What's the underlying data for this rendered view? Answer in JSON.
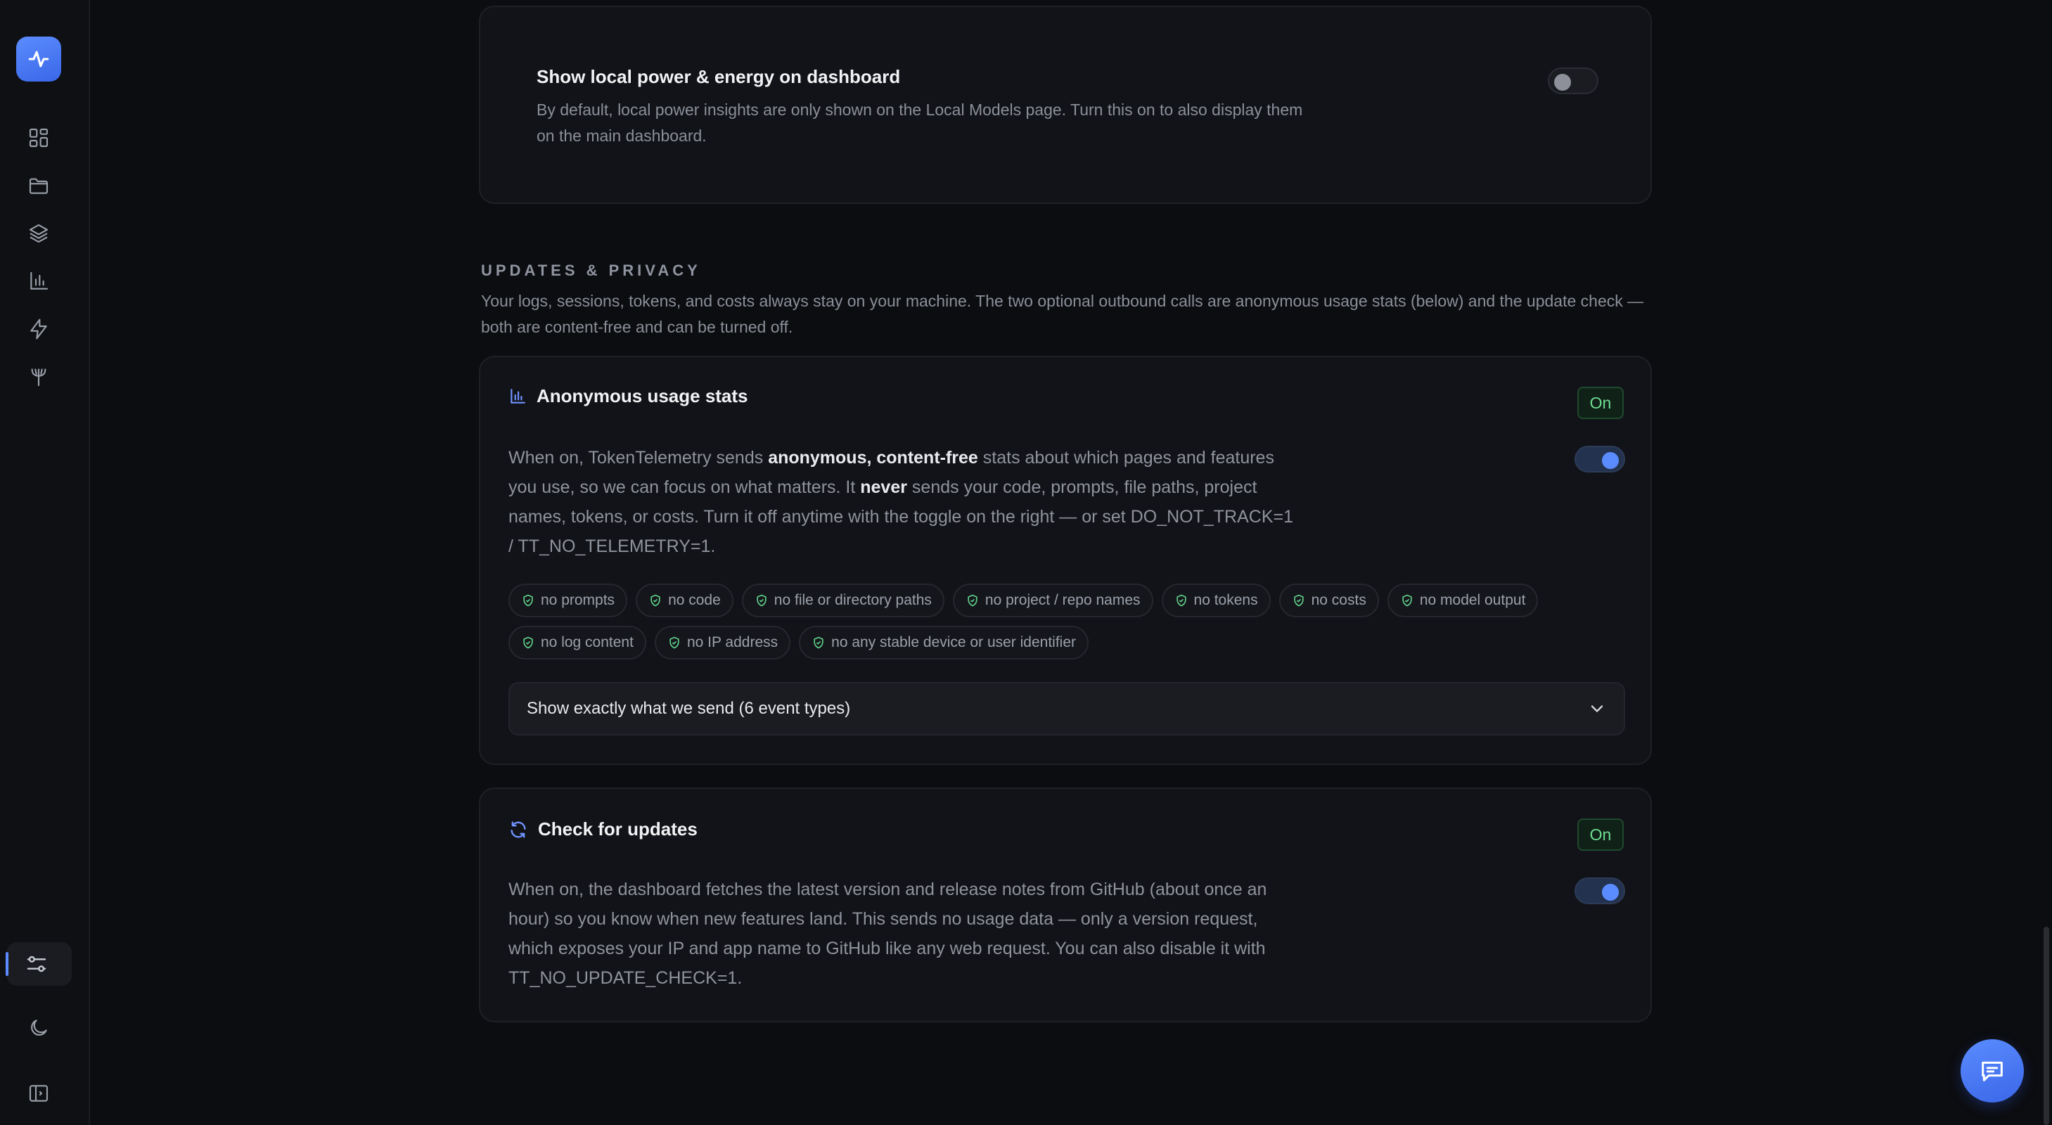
{
  "colors": {
    "accent": "#5b8cff",
    "success": "#6fdc94",
    "background": "#0c0d10"
  },
  "sidebar": {
    "logo_icon": "activity-pulse-icon",
    "nav": [
      {
        "icon": "dashboard-grid-icon"
      },
      {
        "icon": "folder-icon"
      },
      {
        "icon": "layers-icon"
      },
      {
        "icon": "bar-chart-icon"
      },
      {
        "icon": "lightning-icon"
      },
      {
        "icon": "pitchfork-icon"
      }
    ],
    "bottom": [
      {
        "icon": "settings-sliders-icon",
        "active": true
      },
      {
        "icon": "moon-icon"
      },
      {
        "icon": "sidebar-toggle-icon"
      }
    ]
  },
  "power_card": {
    "title": "Show local power & energy on dashboard",
    "description": "By default, local power insights are only shown on the Local Models page. Turn this on to also display them on the main dashboard.",
    "toggle_on": false
  },
  "updates_privacy": {
    "label": "UPDATES & PRIVACY",
    "description": "Your logs, sessions, tokens, and costs always stay on your machine. The two optional outbound calls are anonymous usage stats (below) and the update check — both are content-free and can be turned off."
  },
  "usage_stats": {
    "title": "Anonymous usage stats",
    "badge": "On",
    "toggle_on": true,
    "text_1": "When on, TokenTelemetry sends ",
    "text_bold_1": "anonymous, content-free",
    "text_2": " stats about which pages and features you use, so we can focus on what matters. It ",
    "text_bold_2": "never",
    "text_3": " sends your code, prompts, file paths, project names, tokens, or costs. Turn it off anytime with the toggle on the right — or set DO_NOT_TRACK=1 / TT_NO_TELEMETRY=1.",
    "chips": [
      "no prompts",
      "no code",
      "no file or directory paths",
      "no project / repo names",
      "no tokens",
      "no costs",
      "no model output",
      "no log content",
      "no IP address",
      "no any stable device or user identifier"
    ],
    "expander_label": "Show exactly what we send (6 event types)"
  },
  "updates": {
    "title": "Check for updates",
    "badge": "On",
    "toggle_on": true,
    "text": "When on, the dashboard fetches the latest version and release notes from GitHub (about once an hour) so you know when new features land. This sends no usage data — only a version request, which exposes your IP and app name to GitHub like any web request. You can also disable it with TT_NO_UPDATE_CHECK=1."
  },
  "fab_icon": "chat-bubble-icon"
}
